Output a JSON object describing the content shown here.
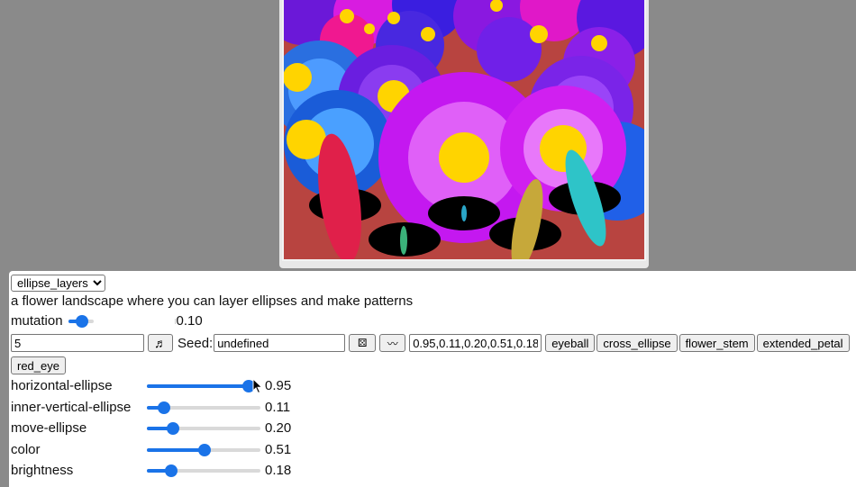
{
  "preset": {
    "selected": "ellipse_layers"
  },
  "description": "a flower landscape where you can layer ellipses and make patterns",
  "mutation": {
    "label": "mutation",
    "value": "0.10",
    "fraction": 0.1
  },
  "controls": {
    "count_value": "5",
    "music_icon": "music-note-icon",
    "seed_label": "Seed:",
    "seed_value": "undefined",
    "dice_icon": "dice-icon",
    "wave_icon": "wave-icon",
    "params_value": "0.95,0.11,0.20,0.51,0.18"
  },
  "pattern_buttons": [
    "eyeball",
    "cross_ellipse",
    "flower_stem",
    "extended_petal",
    "red_eye"
  ],
  "sliders": [
    {
      "label": "horizontal-ellipse",
      "value": "0.95",
      "fraction": 0.95
    },
    {
      "label": "inner-vertical-ellipse",
      "value": "0.11",
      "fraction": 0.11
    },
    {
      "label": "move-ellipse",
      "value": "0.20",
      "fraction": 0.2
    },
    {
      "label": "color",
      "value": "0.51",
      "fraction": 0.51
    },
    {
      "label": "brightness",
      "value": "0.18",
      "fraction": 0.18
    }
  ],
  "colors": {
    "accent": "#1a73e8",
    "canvas_bg": "#b84440",
    "page_bg": "#8a8a8a"
  }
}
